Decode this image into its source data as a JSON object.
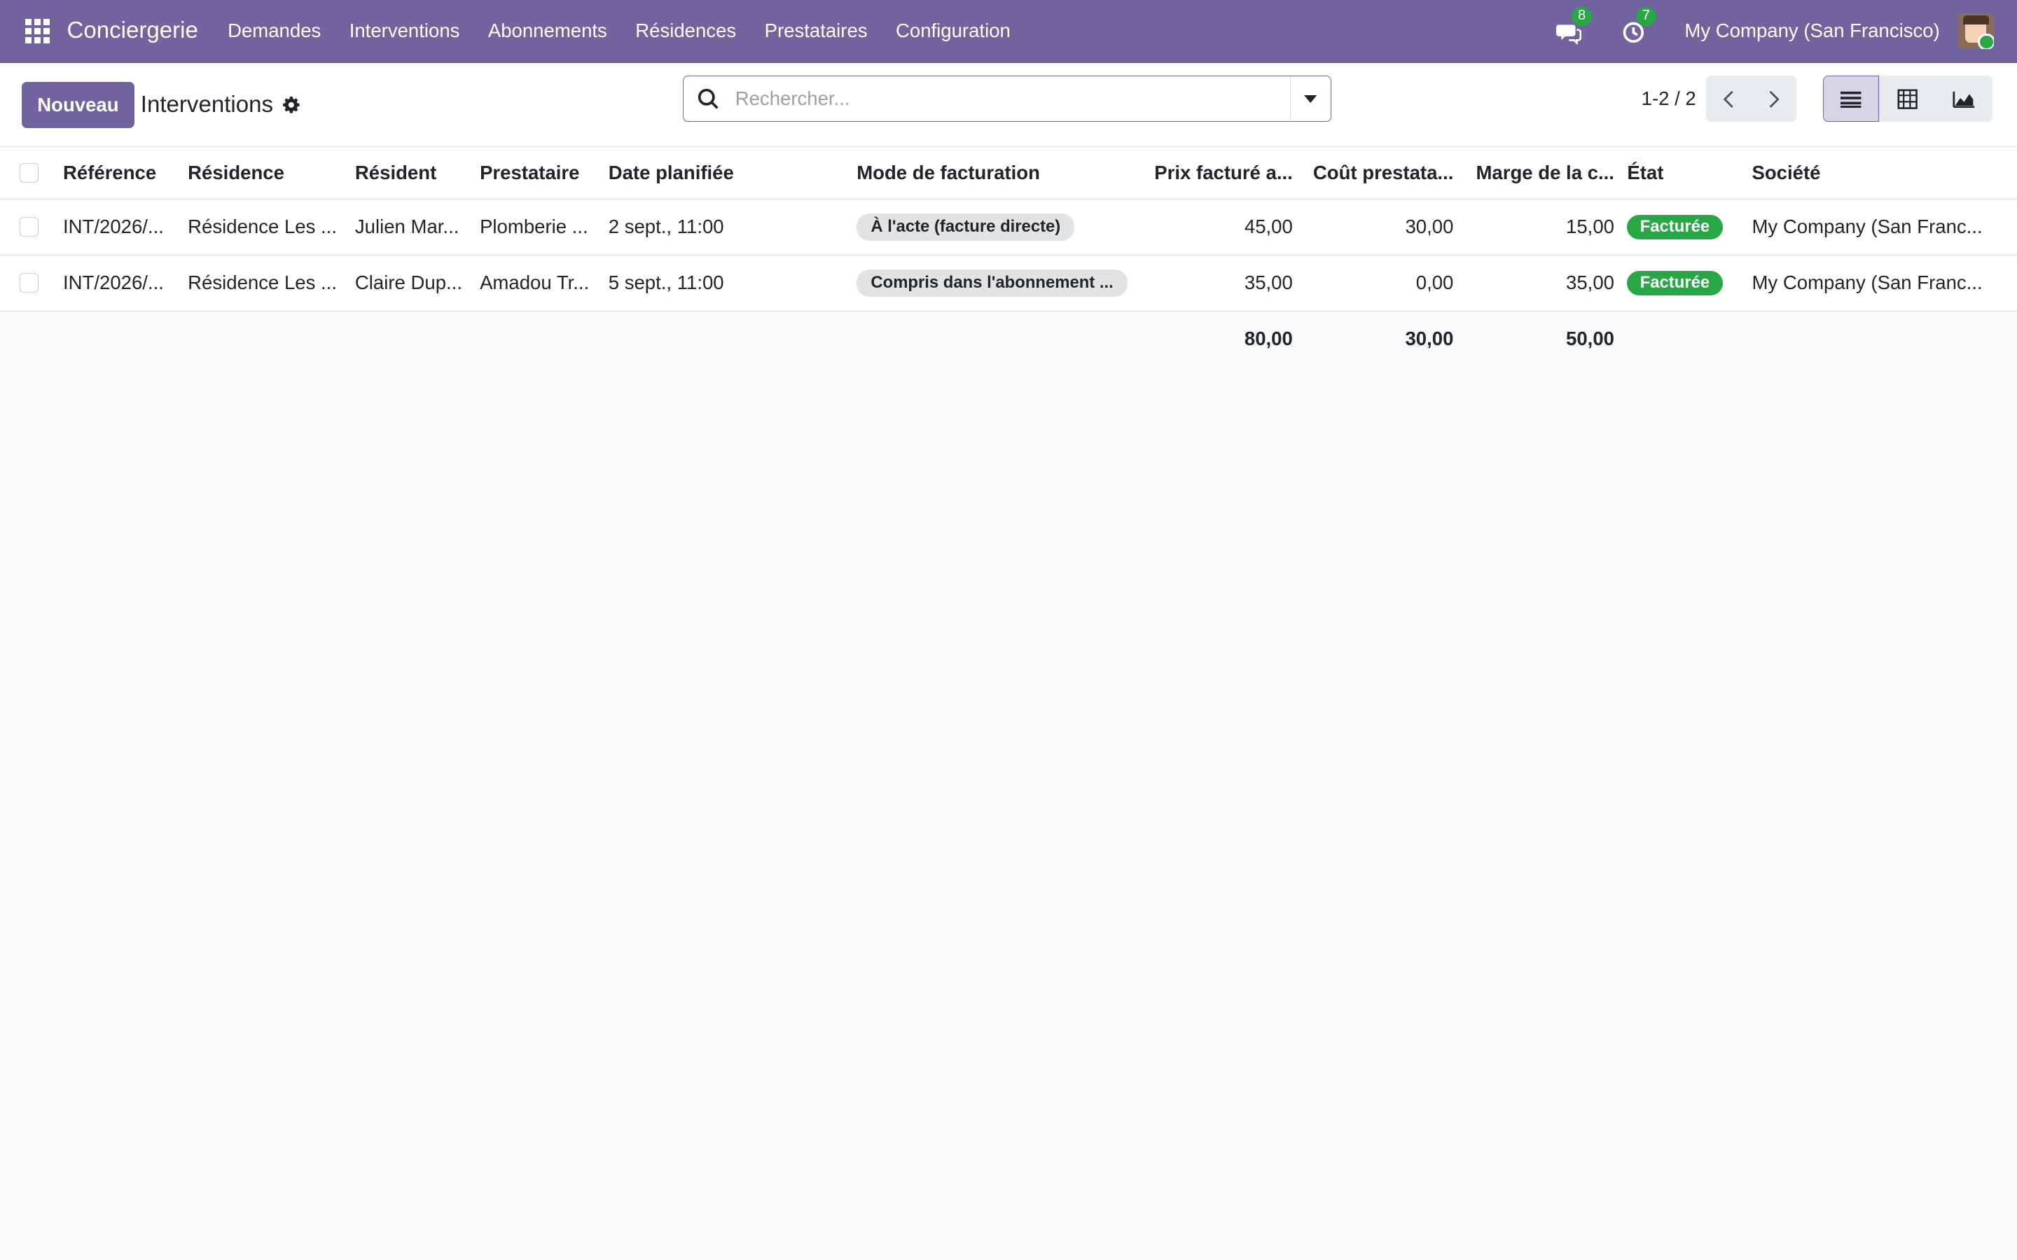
{
  "nav": {
    "brand": "Conciergerie",
    "menu": [
      "Demandes",
      "Interventions",
      "Abonnements",
      "Résidences",
      "Prestataires",
      "Configuration"
    ],
    "messages_count": "8",
    "activities_count": "7",
    "company": "My Company (San Francisco)"
  },
  "control": {
    "new_button": "Nouveau",
    "title": "Interventions",
    "search_placeholder": "Rechercher...",
    "pager": "1-2 / 2"
  },
  "table": {
    "headers": [
      "Référence",
      "Résidence",
      "Résident",
      "Prestataire",
      "Date planifiée",
      "Mode de facturation",
      "Prix facturé a...",
      "Coût prestata...",
      "Marge de la c...",
      "État",
      "Société"
    ],
    "rows": [
      {
        "reference": "INT/2026/...",
        "residence": "Résidence Les ...",
        "resident": "Julien Mar...",
        "prestataire": "Plomberie ...",
        "date": "2 sept., 11:00",
        "mode": "À l'acte (facture directe)",
        "prix": "45,00",
        "cout": "30,00",
        "marge": "15,00",
        "etat": "Facturée",
        "societe": "My Company (San Franc..."
      },
      {
        "reference": "INT/2026/...",
        "residence": "Résidence Les ...",
        "resident": "Claire Dup...",
        "prestataire": "Amadou Tr...",
        "date": "5 sept., 11:00",
        "mode": "Compris dans l'abonnement ...",
        "prix": "35,00",
        "cout": "0,00",
        "marge": "35,00",
        "etat": "Facturée",
        "societe": "My Company (San Franc..."
      }
    ],
    "totals": {
      "prix": "80,00",
      "cout": "30,00",
      "marge": "50,00"
    }
  },
  "colors": {
    "brand": "#71639e",
    "success": "#28a745",
    "tag_bg": "#e2e3e5"
  },
  "icons": [
    "apps-grid-icon",
    "chat-icon",
    "clock-icon",
    "gear-icon",
    "search-icon",
    "caret-down-icon",
    "chevron-left-icon",
    "chevron-right-icon",
    "list-view-icon",
    "pivot-view-icon",
    "graph-view-icon"
  ]
}
